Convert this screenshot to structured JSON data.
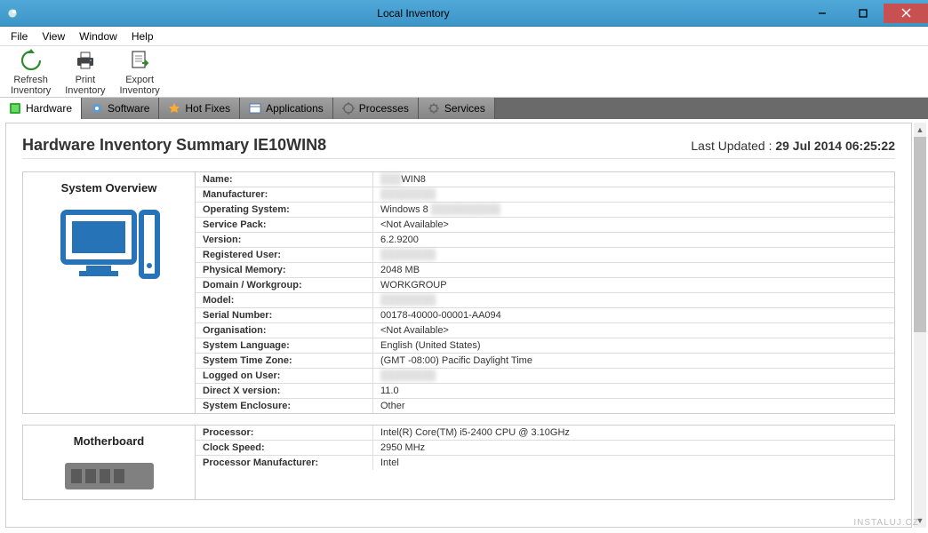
{
  "window": {
    "title": "Local Inventory"
  },
  "menu": {
    "items": [
      "File",
      "View",
      "Window",
      "Help"
    ]
  },
  "toolbar": {
    "items": [
      {
        "label1": "Refresh",
        "label2": "Inventory"
      },
      {
        "label1": "Print",
        "label2": "Inventory"
      },
      {
        "label1": "Export",
        "label2": "Inventory"
      }
    ]
  },
  "tabs": {
    "items": [
      {
        "label": "Hardware",
        "active": true
      },
      {
        "label": "Software",
        "active": false
      },
      {
        "label": "Hot Fixes",
        "active": false
      },
      {
        "label": "Applications",
        "active": false
      },
      {
        "label": "Processes",
        "active": false
      },
      {
        "label": "Services",
        "active": false
      }
    ]
  },
  "page": {
    "heading": "Hardware Inventory Summary IE10WIN8",
    "updated_prefix": "Last Updated : ",
    "updated_value": "29 Jul 2014 06:25:22"
  },
  "sections": [
    {
      "title": "System Overview",
      "icon": "computer-icon",
      "rows": [
        {
          "label": "Name:",
          "value": "WIN8",
          "blur_prefix": true
        },
        {
          "label": "Manufacturer:",
          "value": "",
          "blur": true
        },
        {
          "label": "Operating System:",
          "value": "Windows 8",
          "blur_suffix": true
        },
        {
          "label": "Service Pack:",
          "value": "<Not Available>"
        },
        {
          "label": "Version:",
          "value": "6.2.9200"
        },
        {
          "label": "Registered User:",
          "value": "",
          "blur": true
        },
        {
          "label": "Physical Memory:",
          "value": "2048 MB"
        },
        {
          "label": "Domain / Workgroup:",
          "value": "WORKGROUP"
        },
        {
          "label": "Model:",
          "value": "",
          "blur": true
        },
        {
          "label": "Serial Number:",
          "value": "00178-40000-00001-AA094"
        },
        {
          "label": "Organisation:",
          "value": "<Not Available>"
        },
        {
          "label": "System Language:",
          "value": "English (United States)"
        },
        {
          "label": "System Time Zone:",
          "value": "(GMT -08:00) Pacific Daylight Time"
        },
        {
          "label": "Logged on User:",
          "value": "",
          "blur": true
        },
        {
          "label": "Direct X version:",
          "value": "11.0"
        },
        {
          "label": "System Enclosure:",
          "value": "Other"
        }
      ]
    },
    {
      "title": "Motherboard",
      "icon": "motherboard-icon",
      "rows": [
        {
          "label": "Processor:",
          "value": "Intel(R) Core(TM) i5-2400 CPU @ 3.10GHz"
        },
        {
          "label": "Clock Speed:",
          "value": "2950 MHz"
        },
        {
          "label": "Processor Manufacturer:",
          "value": "Intel"
        }
      ]
    }
  ],
  "watermark": "INSTALUJ.CZ"
}
